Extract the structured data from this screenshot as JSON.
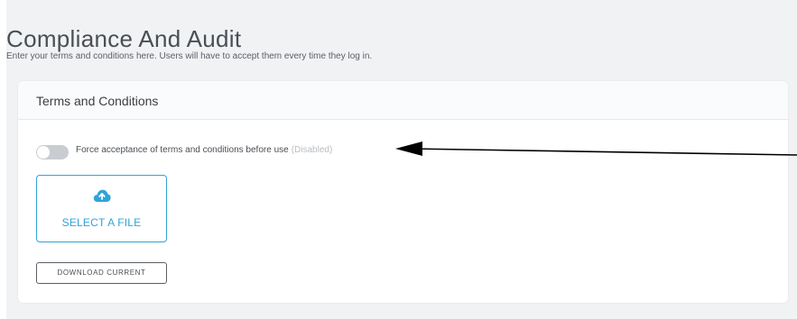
{
  "page": {
    "title": "Compliance And Audit",
    "subtitle": "Enter your terms and conditions here. Users will have to accept them every time they log in."
  },
  "card": {
    "title": "Terms and Conditions",
    "toggle": {
      "label": "Force acceptance of terms and conditions before use",
      "status": "(Disabled)",
      "enabled": false
    },
    "upload": {
      "label": "SELECT A FILE",
      "icon": "cloud-upload-icon"
    },
    "download_label": "DOWNLOAD CURRENT"
  },
  "colors": {
    "accent": "#2fa4d9",
    "background": "#f1f2f4"
  }
}
